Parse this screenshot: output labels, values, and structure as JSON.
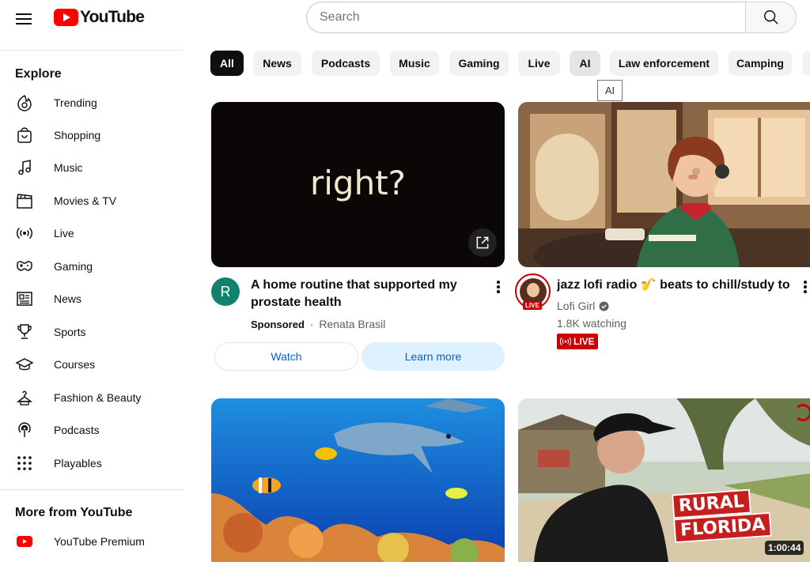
{
  "header": {
    "logo_text": "YouTube",
    "search_placeholder": "Search"
  },
  "sidebar": {
    "explore_title": "Explore",
    "items": [
      {
        "label": "Trending",
        "icon": "trending-icon"
      },
      {
        "label": "Shopping",
        "icon": "shopping-bag-icon"
      },
      {
        "label": "Music",
        "icon": "music-note-icon"
      },
      {
        "label": "Movies & TV",
        "icon": "clapperboard-icon"
      },
      {
        "label": "Live",
        "icon": "live-broadcast-icon"
      },
      {
        "label": "Gaming",
        "icon": "gamepad-icon"
      },
      {
        "label": "News",
        "icon": "newspaper-icon"
      },
      {
        "label": "Sports",
        "icon": "trophy-icon"
      },
      {
        "label": "Courses",
        "icon": "graduation-cap-icon"
      },
      {
        "label": "Fashion & Beauty",
        "icon": "hanger-icon"
      },
      {
        "label": "Podcasts",
        "icon": "podcast-icon"
      },
      {
        "label": "Playables",
        "icon": "playables-grid-icon"
      }
    ],
    "more_title": "More from YouTube",
    "more_items": [
      {
        "label": "YouTube Premium",
        "icon": "youtube-premium-icon"
      }
    ]
  },
  "chips": [
    "All",
    "News",
    "Podcasts",
    "Music",
    "Gaming",
    "Live",
    "AI",
    "Law enforcement",
    "Camping"
  ],
  "tooltip": "AI",
  "ad_card": {
    "thumbnail_text": "right?",
    "avatar_letter": "R",
    "title_line1": "A home routine that supported my",
    "title_line2": "prostate health",
    "sponsored": "Sponsored",
    "separator": "·",
    "advertiser": "Renata Brasil",
    "watch_label": "Watch",
    "learn_more_label": "Learn more"
  },
  "live_card": {
    "title": "jazz lofi radio 🎷 beats to chill/study to",
    "channel": "Lofi Girl",
    "watching": "1.8K watching",
    "live_badge": "LIVE",
    "avatar_badge": "LIVE"
  },
  "video_card_3": {
    "overlay_line1": "RURAL",
    "overlay_line2": "FLORIDA",
    "duration": "1:00:44"
  },
  "colors": {
    "brand_red": "#ff0000",
    "live_red": "#cc0000",
    "link_blue": "#065fd4",
    "chip_bg": "#f2f2f2",
    "ad_avatar_teal": "#11826d"
  }
}
